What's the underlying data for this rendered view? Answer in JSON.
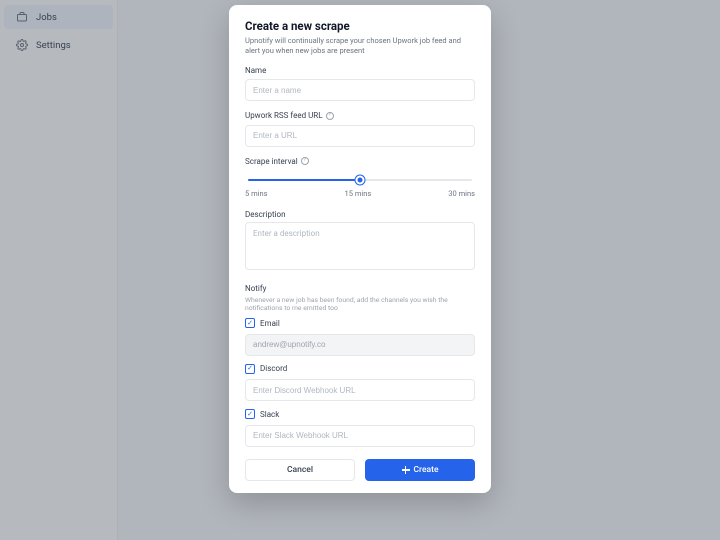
{
  "sidebar": {
    "items": [
      {
        "label": "Jobs"
      },
      {
        "label": "Settings"
      }
    ]
  },
  "modal": {
    "title": "Create a new scrape",
    "subtitle": "Upnotify will continually scrape your chosen Upwork job feed and alert you when new jobs are present",
    "name": {
      "label": "Name",
      "placeholder": "Enter a name"
    },
    "url": {
      "label": "Upwork RSS feed URL",
      "placeholder": "Enter a URL"
    },
    "interval": {
      "label": "Scrape interval",
      "min_label": "5 mins",
      "mid_label": "15 mins",
      "max_label": "30 mins"
    },
    "description": {
      "label": "Description",
      "placeholder": "Enter a description"
    },
    "notify": {
      "label": "Notify",
      "help_text": "Whenever a new job has been found, add the channels you wish the notifications to me emitted too",
      "email": {
        "label": "Email",
        "value": "andrew@upnotify.co"
      },
      "discord": {
        "label": "Discord",
        "placeholder": "Enter Discord Webhook URL"
      },
      "slack": {
        "label": "Slack",
        "placeholder": "Enter Slack Webhook URL"
      }
    },
    "buttons": {
      "cancel": "Cancel",
      "create": "Create"
    }
  }
}
